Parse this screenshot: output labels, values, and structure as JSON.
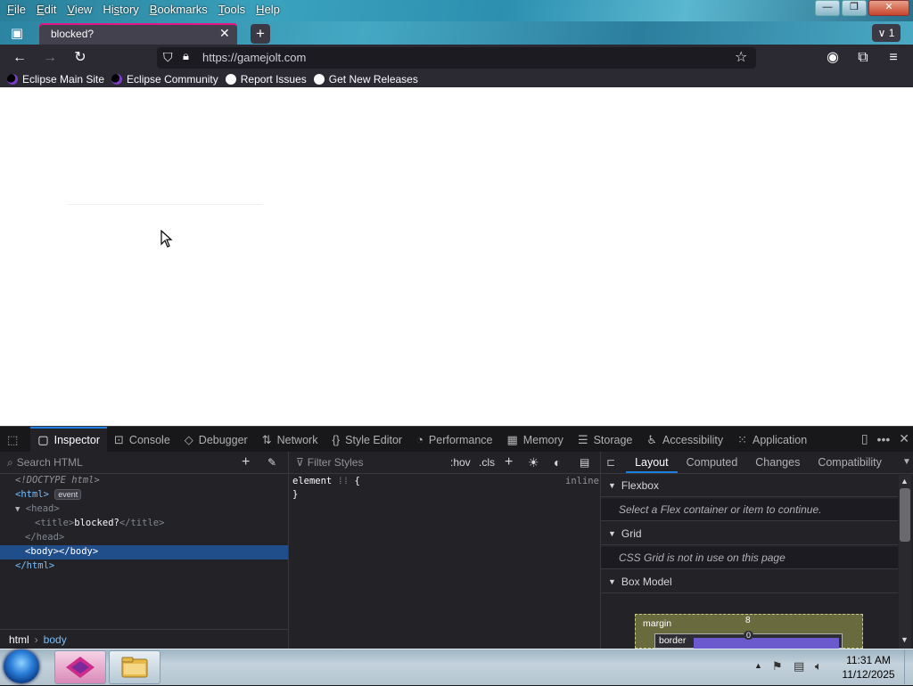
{
  "menubar": {
    "items": [
      {
        "pre": "",
        "u": "F",
        "post": "ile"
      },
      {
        "pre": "",
        "u": "E",
        "post": "dit"
      },
      {
        "pre": "",
        "u": "V",
        "post": "iew"
      },
      {
        "pre": "Hi",
        "u": "s",
        "post": "tory"
      },
      {
        "pre": "",
        "u": "B",
        "post": "ookmarks"
      },
      {
        "pre": "",
        "u": "T",
        "post": "ools"
      },
      {
        "pre": "",
        "u": "H",
        "post": "elp"
      }
    ]
  },
  "tab": {
    "title": "blocked?",
    "list_all_count": "1"
  },
  "urlbar": {
    "url": "https://gamejolt.com"
  },
  "bookmarks": [
    {
      "label": "Eclipse Main Site",
      "icon": "eclipse"
    },
    {
      "label": "Eclipse Community",
      "icon": "eclipse"
    },
    {
      "label": "Report Issues",
      "icon": "gh"
    },
    {
      "label": "Get New Releases",
      "icon": "gh"
    }
  ],
  "devtools": {
    "tabs": [
      {
        "label": "Inspector",
        "icon": "▢"
      },
      {
        "label": "Console",
        "icon": "⊡"
      },
      {
        "label": "Debugger",
        "icon": "◇"
      },
      {
        "label": "Network",
        "icon": "⇅"
      },
      {
        "label": "Style Editor",
        "icon": "{}"
      },
      {
        "label": "Performance",
        "icon": "◔"
      },
      {
        "label": "Memory",
        "icon": "▦"
      },
      {
        "label": "Storage",
        "icon": "☰"
      },
      {
        "label": "Accessibility",
        "icon": "♿"
      },
      {
        "label": "Application",
        "icon": "⁙"
      }
    ],
    "search_html_placeholder": "Search HTML",
    "filter_styles_placeholder": "Filter Styles",
    "hov": ":hov",
    "cls": ".cls",
    "markup": {
      "doctype": "<!DOCTYPE html>",
      "html_open": "<html>",
      "event_badge": "event",
      "head_open": "<head>",
      "title_open": "<title>",
      "title_text": "blocked?",
      "title_close": "</title>",
      "head_close": "</head>",
      "body": "<body></body>",
      "html_close": "</html>"
    },
    "rules": {
      "selector": "element",
      "brace_open": "{",
      "brace_close": "}",
      "source": "inline"
    },
    "layout_tabs": [
      "Layout",
      "Computed",
      "Changes",
      "Compatibility"
    ],
    "sections": {
      "flexbox_title": "Flexbox",
      "flexbox_msg": "Select a Flex container or item to continue.",
      "grid_title": "Grid",
      "grid_msg": "CSS Grid is not in use on this page",
      "boxmodel_title": "Box Model",
      "margin_label": "margin",
      "margin_value": "8",
      "border_label": "border",
      "border_value": "0"
    },
    "breadcrumbs": [
      "html",
      "body"
    ]
  },
  "taskbar": {
    "time": "11:31 AM",
    "date": "11/12/2025"
  }
}
